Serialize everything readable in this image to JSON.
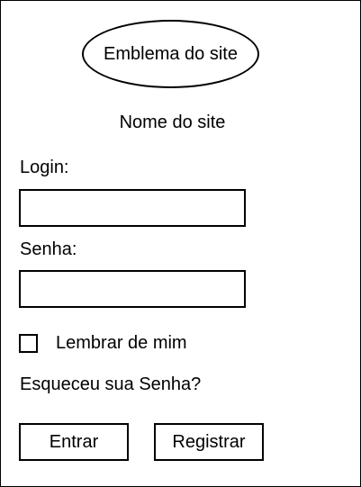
{
  "header": {
    "emblem_label": "Emblema do site",
    "site_name": "Nome do site"
  },
  "login_form": {
    "login_label": "Login:",
    "login_value": "",
    "password_label": "Senha:",
    "password_value": "",
    "remember_label": "Lembrar de mim",
    "remember_checked": false,
    "forgot_password_text": "Esqueceu sua Senha?",
    "enter_button_label": "Entrar",
    "register_button_label": "Registrar"
  }
}
